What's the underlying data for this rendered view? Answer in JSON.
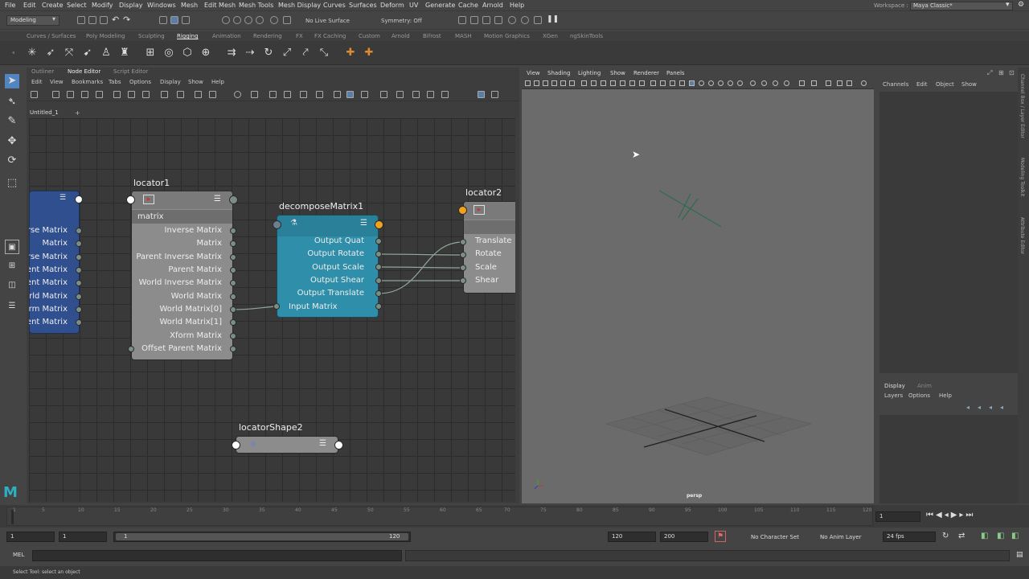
{
  "menubar": {
    "items": [
      "File",
      "Edit",
      "Create",
      "Select",
      "Modify",
      "Display",
      "Windows",
      "Mesh",
      "Edit Mesh",
      "Mesh Tools",
      "Mesh Display",
      "Curves",
      "Surfaces",
      "Deform",
      "UV",
      "Generate",
      "Cache",
      "Arnold",
      "Help"
    ],
    "workspace_label": "Workspace :",
    "workspace_value": "Maya Classic*"
  },
  "statusline": {
    "mode": "Modeling",
    "live_surface": "No Live Surface",
    "symmetry": "Symmetry: Off"
  },
  "shelf": {
    "tabs": [
      "Curves / Surfaces",
      "Poly Modeling",
      "Sculpting",
      "Rigging",
      "Animation",
      "Rendering",
      "FX",
      "FX Caching",
      "Custom",
      "Arnold",
      "Bifrost",
      "MASH",
      "Motion Graphics",
      "XGen",
      "ngSkinTools"
    ],
    "active_tab": "Rigging"
  },
  "node_editor": {
    "tabs": [
      "Outliner",
      "Node Editor",
      "Script Editor"
    ],
    "active_tab": "Node Editor",
    "menu": [
      "Edit",
      "View",
      "Bookmarks",
      "Tabs",
      "Options",
      "Display",
      "Show",
      "Help"
    ],
    "doc_tab": "Untitled_1",
    "doc_plus": "+",
    "left_node_ports": [
      "erse Matrix",
      "Matrix",
      "erse Matrix",
      "ent Matrix",
      "erent Matrix",
      "orld Matrix",
      "form Matrix",
      "ent Matrix"
    ],
    "locator1": {
      "title": "locator1",
      "subheader": "matrix",
      "ports": [
        "Inverse Matrix",
        "Matrix",
        "Parent Inverse Matrix",
        "Parent Matrix",
        "World Inverse Matrix",
        "World Matrix",
        "World Matrix[0]",
        "World Matrix[1]",
        "Xform Matrix",
        "Offset Parent Matrix"
      ]
    },
    "decompose": {
      "title": "decomposeMatrix1",
      "outputs": [
        "Output Quat",
        "Output Rotate",
        "Output Scale",
        "Output Shear",
        "Output Translate"
      ],
      "input": "Input Matrix"
    },
    "locator2": {
      "title": "locator2",
      "ports": [
        "Translate",
        "Rotate",
        "Scale",
        "Shear"
      ]
    },
    "locatorShape2": {
      "title": "locatorShape2"
    }
  },
  "viewport": {
    "menu": [
      "View",
      "Shading",
      "Lighting",
      "Show",
      "Renderer",
      "Panels"
    ],
    "camera": "persp"
  },
  "channel_box": {
    "menu": [
      "Channels",
      "Edit",
      "Object",
      "Show"
    ],
    "layer_tabs": [
      "Display",
      "Anim"
    ],
    "active_layer_tab": "Display",
    "layer_menu": [
      "Layers",
      "Options",
      "Help"
    ],
    "side_labels": [
      "Channel Box / Layer Editor",
      "Modeling Toolkit",
      "Attribute Editor"
    ]
  },
  "timeline": {
    "ticks": [
      "1",
      "5",
      "10",
      "15",
      "20",
      "25",
      "30",
      "35",
      "40",
      "45",
      "50",
      "55",
      "60",
      "65",
      "70",
      "75",
      "80",
      "85",
      "90",
      "95",
      "100",
      "105",
      "110",
      "115",
      "120"
    ],
    "current_frame": "1"
  },
  "range": {
    "start": "1",
    "playback_start": "1",
    "slider_start": "1",
    "slider_end": "120",
    "playback_end": "120",
    "end": "200",
    "character_set": "No Character Set",
    "anim_layer": "No Anim Layer",
    "fps": "24 fps"
  },
  "command_line": {
    "label": "MEL"
  },
  "help_line": {
    "text": "Select Tool: select an object"
  }
}
